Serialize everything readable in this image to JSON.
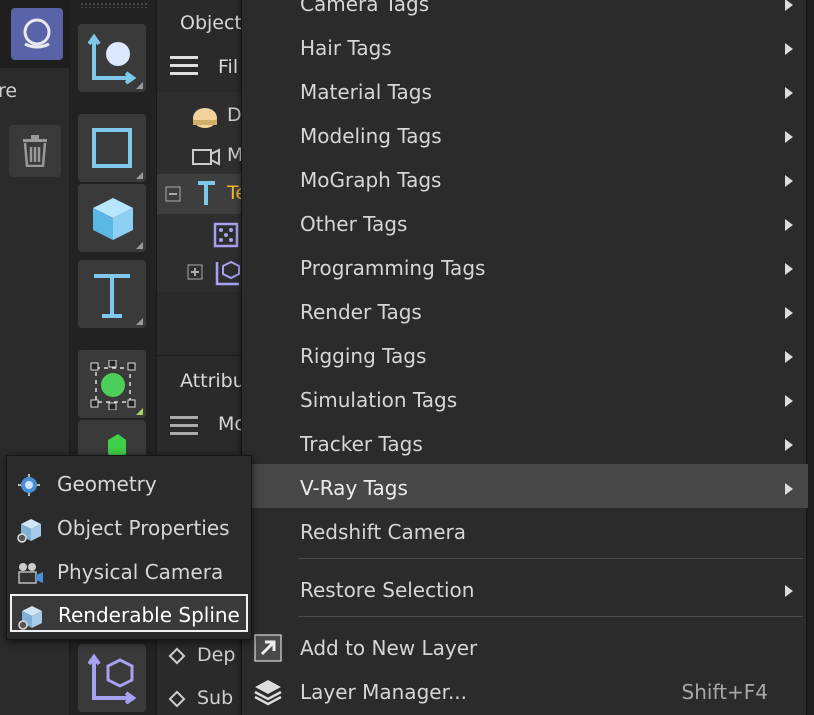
{
  "left_panel": {
    "partial_label": "re"
  },
  "object_manager": {
    "title": "Object",
    "menu_text": "Fil",
    "tree_rows": [
      {
        "label": "D"
      },
      {
        "label": "M"
      },
      {
        "label": "Te"
      },
      {
        "label": ""
      },
      {
        "label": ""
      }
    ]
  },
  "attributes": {
    "title": "Attribu",
    "menu_text": "Mo",
    "rows": [
      {
        "label": "Dep"
      },
      {
        "label": "Sub"
      }
    ]
  },
  "context_menu": {
    "items": [
      {
        "label": "Camera Tags",
        "has_submenu": true
      },
      {
        "label": "Hair Tags",
        "has_submenu": true
      },
      {
        "label": "Material Tags",
        "has_submenu": true
      },
      {
        "label": "Modeling Tags",
        "has_submenu": true
      },
      {
        "label": "MoGraph Tags",
        "has_submenu": true
      },
      {
        "label": "Other Tags",
        "has_submenu": true
      },
      {
        "label": "Programming Tags",
        "has_submenu": true
      },
      {
        "label": "Render Tags",
        "has_submenu": true
      },
      {
        "label": "Rigging Tags",
        "has_submenu": true
      },
      {
        "label": "Simulation Tags",
        "has_submenu": true
      },
      {
        "label": "Tracker Tags",
        "has_submenu": true
      },
      {
        "label": "V-Ray Tags",
        "has_submenu": true,
        "highlighted": true
      }
    ],
    "redshift_camera": "Redshift Camera",
    "restore_selection": "Restore Selection",
    "add_to_new_layer": "Add to New Layer",
    "layer_manager": "Layer Manager...",
    "layer_manager_shortcut": "Shift+F4"
  },
  "vray_submenu": {
    "items": [
      {
        "label": "Geometry",
        "icon": "geometry-icon"
      },
      {
        "label": "Object Properties",
        "icon": "object-properties-icon"
      },
      {
        "label": "Physical Camera",
        "icon": "physical-camera-icon"
      },
      {
        "label": "Renderable Spline",
        "icon": "renderable-spline-icon",
        "focused": true
      }
    ]
  },
  "colors": {
    "menu_bg": "#2b2b2b",
    "highlight_bg": "#474747",
    "selected_object_text": "#f0b830",
    "icon_blue": "#7ec8ec",
    "logo_bg": "#5a63a8"
  }
}
